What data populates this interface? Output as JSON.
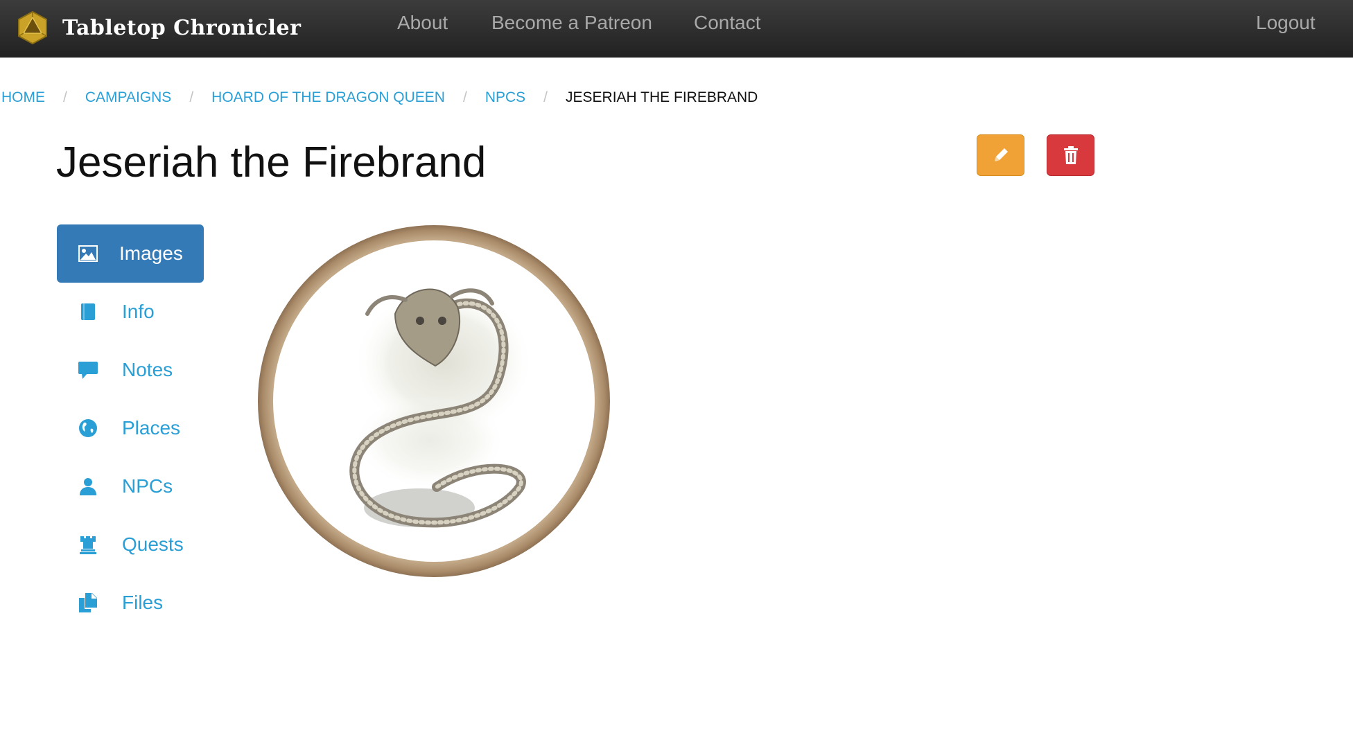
{
  "app": {
    "brand": "Tabletop Chronicler",
    "nav": {
      "about": "About",
      "patreon": "Become a Patreon",
      "contact": "Contact",
      "logout": "Logout"
    }
  },
  "breadcrumb": {
    "items": [
      "HOME",
      "CAMPAIGNS",
      "HOARD OF THE DRAGON QUEEN",
      "NPCS"
    ],
    "separator": "/",
    "current": "JESERIAH THE FIREBRAND"
  },
  "page": {
    "title": "Jeseriah the Firebrand"
  },
  "actions": {
    "edit_icon": "pencil-icon",
    "delete_icon": "trash-icon"
  },
  "sidenav": {
    "items": [
      {
        "label": "Images",
        "icon": "picture-icon",
        "active": true
      },
      {
        "label": "Info",
        "icon": "book-icon",
        "active": false
      },
      {
        "label": "Notes",
        "icon": "comment-icon",
        "active": false
      },
      {
        "label": "Places",
        "icon": "globe-icon",
        "active": false
      },
      {
        "label": "NPCs",
        "icon": "user-icon",
        "active": false
      },
      {
        "label": "Quests",
        "icon": "tower-icon",
        "active": false
      },
      {
        "label": "Files",
        "icon": "duplicate-icon",
        "active": false
      }
    ]
  },
  "colors": {
    "navbar": "#2b2b2b",
    "link": "#2a9fd6",
    "active_tab": "#337ab7",
    "edit_button": "#f0a236",
    "delete_button": "#d8393c",
    "portrait_frame": "#b89c7c"
  }
}
